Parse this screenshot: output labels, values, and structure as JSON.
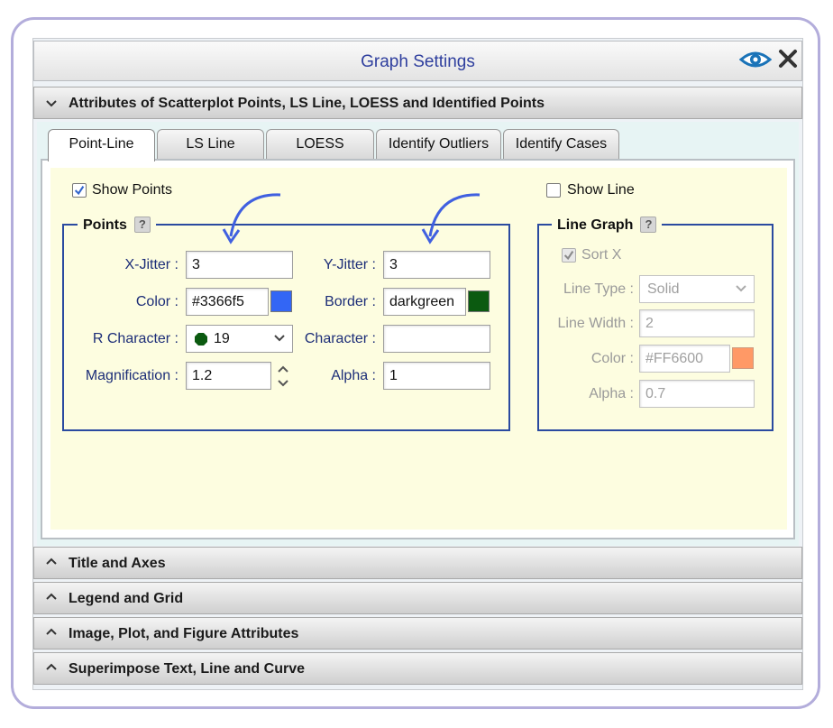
{
  "window": {
    "title": "Graph Settings",
    "eye_icon": "eye-icon",
    "close_icon": "close-icon"
  },
  "sections": {
    "main": "Attributes of Scatterplot Points, LS Line, LOESS and Identified Points",
    "collapsed": [
      "Title and Axes",
      "Legend and Grid",
      "Image, Plot, and Figure Attributes",
      "Superimpose Text, Line and Curve"
    ]
  },
  "tabs": [
    "Point-Line",
    "LS Line",
    "LOESS",
    "Identify Outliers",
    "Identify Cases"
  ],
  "points": {
    "show_label": "Show Points",
    "show_checked": true,
    "legend": "Points",
    "help": "?",
    "x_jitter": {
      "label": "X-Jitter :",
      "value": "3"
    },
    "y_jitter": {
      "label": "Y-Jitter :",
      "value": "3"
    },
    "color": {
      "label": "Color :",
      "value": "#3366f5",
      "swatch": "#3366f5"
    },
    "border": {
      "label": "Border :",
      "value": "darkgreen",
      "swatch": "#0b5a10"
    },
    "r_character": {
      "label": "R Character :",
      "value": "19",
      "icon": "filled-circle-icon"
    },
    "character": {
      "label": "Character :",
      "value": ""
    },
    "magnification": {
      "label": "Magnification :",
      "value": "1.2"
    },
    "alpha": {
      "label": "Alpha :",
      "value": "1"
    }
  },
  "line": {
    "show_label": "Show Line",
    "show_checked": false,
    "legend": "Line Graph",
    "help": "?",
    "sort_x": {
      "label": "Sort X",
      "checked": true
    },
    "line_type": {
      "label": "Line Type :",
      "value": "Solid"
    },
    "line_width": {
      "label": "Line Width :",
      "value": "2"
    },
    "color": {
      "label": "Color :",
      "value": "#FF6600",
      "swatch": "#ff9966"
    },
    "alpha": {
      "label": "Alpha :",
      "value": "0.7"
    }
  },
  "colors": {
    "accent": "#3366f5",
    "label_text": "#1d2e78",
    "fieldset_border": "#2a4aa0",
    "panel_bg": "#fdfde0",
    "arrow": "#4060e0"
  }
}
